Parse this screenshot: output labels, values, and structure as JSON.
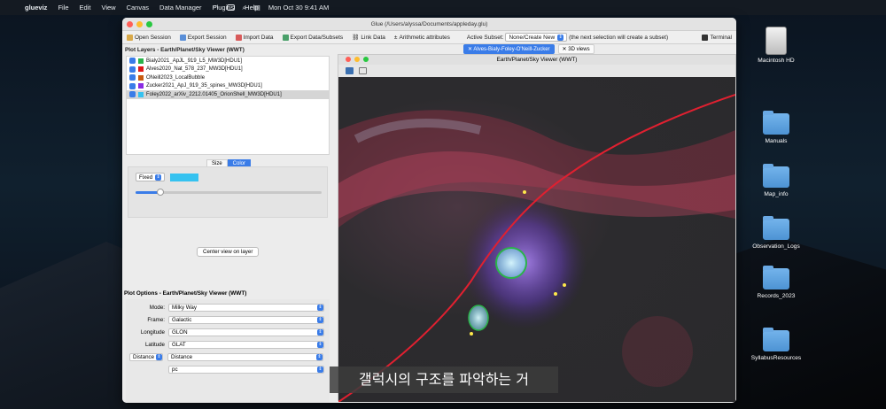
{
  "menubar": {
    "app": "glueviz",
    "items": [
      "File",
      "Edit",
      "View",
      "Canvas",
      "Data Manager",
      "Plugins",
      "Help"
    ],
    "clock": "Mon Oct 30  9:41 AM"
  },
  "desktop": {
    "icons": [
      "Macintosh HD",
      "Manuals",
      "Map_info",
      "Observation_Logs",
      "Records_2023",
      "SyllabusResources"
    ]
  },
  "window": {
    "title": "Glue (/Users/alyssa/Documents/appleday.glu)"
  },
  "toolbar": {
    "open": "Open Session",
    "export": "Export Session",
    "import": "Import Data",
    "export_data": "Export Data/Subsets",
    "link": "Link Data",
    "arith": "Arithmetic attributes",
    "active_subset_label": "Active Subset:",
    "active_subset_value": "None/Create New",
    "hint": "(the next selection will create a subset)",
    "terminal": "Terminal"
  },
  "plot_layers": {
    "title": "Plot Layers - Earth/Planet/Sky Viewer (WWT)",
    "layers": [
      {
        "name": "Bialy2021_ApJL_919_L5_MW3D[HDU1]",
        "color": "#2bb34a"
      },
      {
        "name": "Alves2020_Nat_578_237_MW3D[HDU1]",
        "color": "#e01818"
      },
      {
        "name": "ONeill2023_LocalBubble",
        "color": "#c85a10"
      },
      {
        "name": "Zucker2021_ApJ_919_35_spines_MW3D[HDU1]",
        "color": "#8a2be2"
      },
      {
        "name": "Foley2022_arXiv_2212.01405_OrionShell_MW3D[HDU1]",
        "color": "#35c2f0"
      }
    ]
  },
  "style_tabs": {
    "size": "Size",
    "color": "Color"
  },
  "style": {
    "mode": "Fixed"
  },
  "center_btn": "Center view on layer",
  "plot_options": {
    "title": "Plot Options - Earth/Planet/Sky Viewer (WWT)",
    "mode_label": "Mode:",
    "mode": "Milky Way",
    "frame_label": "Frame:",
    "frame": "Galactic",
    "lon_label": "Longitude",
    "lon": "GLON",
    "lat_label": "Latitude",
    "lat": "GLAT",
    "dist_label": "Distance",
    "dist": "Distance",
    "unit": "pc"
  },
  "tabs": {
    "t1": "Alves-Bialy-Foley-O'Neill-Zucker",
    "t2": "3D views"
  },
  "viewer": {
    "title": "Earth/Planet/Sky Viewer (WWT)"
  },
  "subtitle": "갤럭시의 구조를 파악하는 거"
}
